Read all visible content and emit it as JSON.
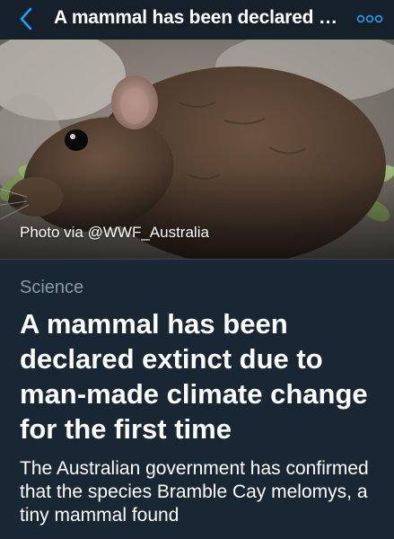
{
  "topbar": {
    "title": "A mammal has been declared extinct due to man-made climate change for the first time",
    "back_icon": "chevron-left-icon",
    "more_icon": "ellipsis-circles-icon",
    "accent_color": "#1da1f2"
  },
  "hero": {
    "caption": "Photo via @WWF_Australia"
  },
  "article": {
    "category": "Science",
    "headline": "A mammal has been declared extinct due to man-made climate change for the first time",
    "summary": "The Australian government has confirmed that the species Bramble Cay melomys, a tiny mammal found"
  },
  "colors": {
    "background": "#15202b",
    "card_background": "#192734",
    "muted_text": "#8899a6"
  }
}
